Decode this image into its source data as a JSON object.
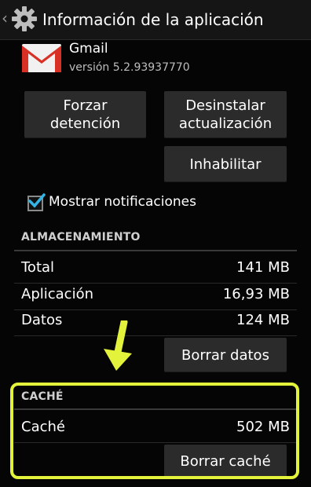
{
  "actionbar": {
    "title": "Información de la aplicación"
  },
  "app": {
    "name": "Gmail",
    "version": "versión 5.2.93937770"
  },
  "buttons": {
    "force_stop": "Forzar detención",
    "uninstall_updates": "Desinstalar actualización",
    "disable": "Inhabilitar",
    "clear_data": "Borrar datos",
    "clear_cache": "Borrar caché"
  },
  "notifications": {
    "label": "Mostrar notificaciones",
    "checked": true
  },
  "storage": {
    "header": "ALMACENAMIENTO",
    "rows": [
      {
        "label": "Total",
        "value": "141 MB"
      },
      {
        "label": "Aplicación",
        "value": "16,93 MB"
      },
      {
        "label": "Datos",
        "value": "124 MB"
      }
    ]
  },
  "cache": {
    "header": "CACHÉ",
    "row": {
      "label": "Caché",
      "value": "502 MB"
    }
  },
  "colors": {
    "highlight": "#e3f23a",
    "check": "#33b5e5",
    "gmail_red": "#d93025"
  },
  "icons": [
    "back-chevron-icon",
    "settings-gear-icon",
    "gmail-icon",
    "checkbox-icon",
    "arrow-down-icon"
  ]
}
